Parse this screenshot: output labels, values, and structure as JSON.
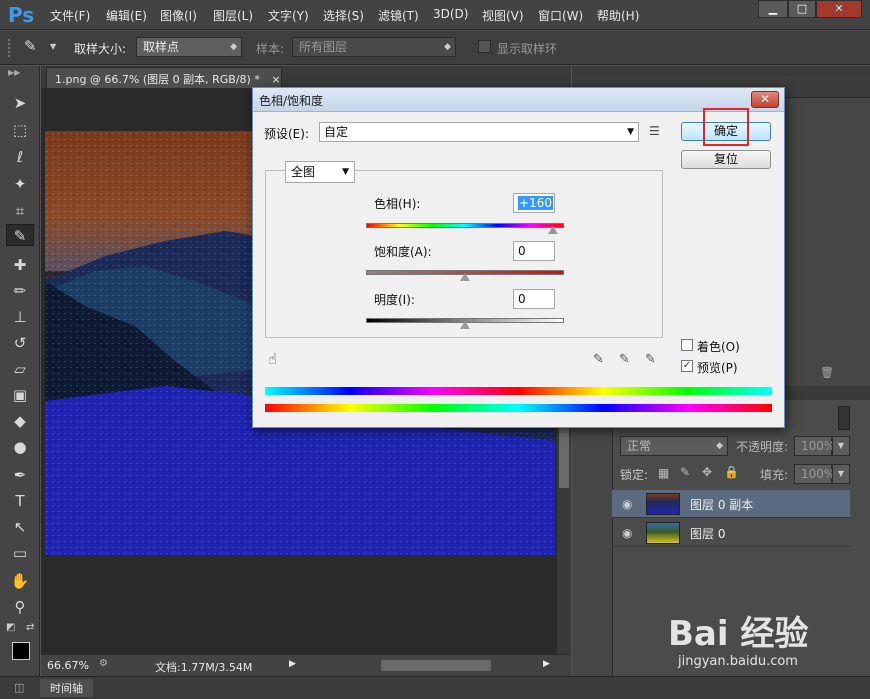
{
  "app": {
    "logo": "Ps"
  },
  "menu": [
    "文件(F)",
    "编辑(E)",
    "图像(I)",
    "图层(L)",
    "文字(Y)",
    "选择(S)",
    "滤镜(T)",
    "3D(D)",
    "视图(V)",
    "窗口(W)",
    "帮助(H)"
  ],
  "window_buttons": {
    "minimize": "▁",
    "maximize": "□",
    "close": "✕"
  },
  "options": {
    "sample_size_label": "取样大小:",
    "sample_size_value": "取样点",
    "sample_label": "样本:",
    "sample_value": "所有图层",
    "show_ring_label": "显示取样环"
  },
  "document": {
    "tab_title": "1.png @ 66.7% (图层 0 副本, RGB/8) *",
    "tab_close": "×",
    "zoom": "66.67%",
    "doc_info": "文档:1.77M/3.54M"
  },
  "timeline": {
    "label": "时间轴"
  },
  "dialog": {
    "title": "色相/饱和度",
    "close": "✕",
    "preset_label": "预设(E):",
    "preset_value": "自定",
    "channel_value": "全图",
    "hue_label": "色相(H):",
    "hue_value": "+160",
    "saturation_label": "饱和度(A):",
    "saturation_value": "0",
    "lightness_label": "明度(I):",
    "lightness_value": "0",
    "ok_button": "确定",
    "reset_button": "复位",
    "colorize_label": "着色(O)",
    "colorize_checked": false,
    "preview_label": "预览(P)",
    "preview_checked": true,
    "check_mark": "✓",
    "hue_slider_level": 0.944,
    "saturation_slider_level": 0.5,
    "lightness_slider_level": 0.5
  },
  "layers": {
    "blend_mode": "正常",
    "opacity_label": "不透明度:",
    "opacity_value": "100%",
    "lock_label": "锁定:",
    "fill_label": "填充:",
    "fill_value": "100%",
    "items": [
      {
        "name": "图层 0 副本",
        "selected": true
      },
      {
        "name": "图层 0",
        "selected": false
      }
    ]
  },
  "watermark": {
    "brand": "Bai 经验",
    "url": "jingyan.baidu.com"
  },
  "colors": {
    "accent": "#3d9be9",
    "highlight": "#e3262b",
    "selected_layer": "#5b6b80"
  }
}
